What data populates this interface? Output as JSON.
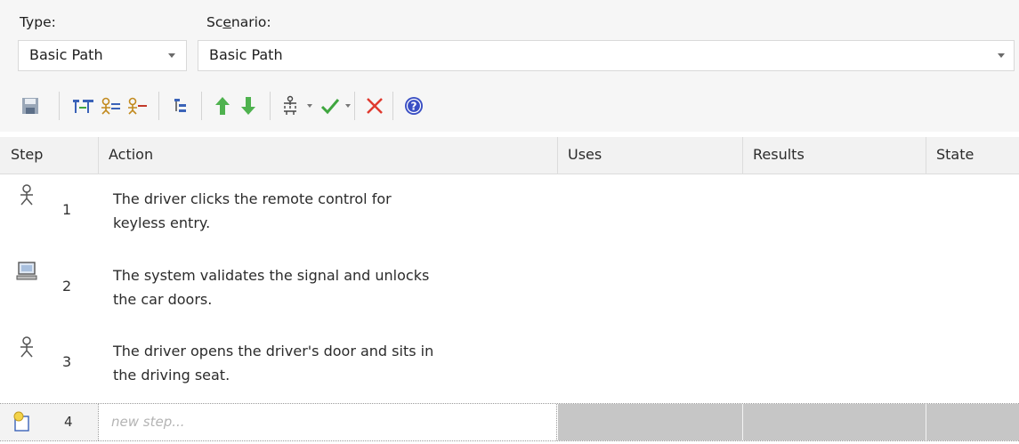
{
  "labels": {
    "type": "Type:",
    "scenario_pre": "Sc",
    "scenario_u": "e",
    "scenario_post": "nario:"
  },
  "combos": {
    "type_value": "Basic Path",
    "scenario_value": "Basic Path"
  },
  "toolbar": {
    "icons": [
      "save-icon",
      "insert-steps-icon",
      "actor-step-icon",
      "system-step-icon",
      "level-icon",
      "move-up-icon",
      "move-down-icon",
      "structure-icon",
      "validate-icon",
      "delete-icon",
      "help-icon"
    ]
  },
  "table": {
    "headers": {
      "step": "Step",
      "action": "Action",
      "uses": "Uses",
      "results": "Results",
      "state": "State"
    },
    "rows": [
      {
        "num": "1",
        "icon": "actor-icon",
        "line1": "The driver clicks the remote control for",
        "line2": "keyless entry."
      },
      {
        "num": "2",
        "icon": "system-icon",
        "line1": "The system validates the signal and unlocks",
        "line2": "the car doors."
      },
      {
        "num": "3",
        "icon": "actor-icon",
        "line1": "The driver opens the driver's door and sits in",
        "line2": "the driving seat."
      }
    ],
    "new_row": {
      "num": "4",
      "placeholder": "new step..."
    }
  },
  "colors": {
    "accent_green": "#3fa63f",
    "delete_red": "#e03a2f",
    "help_blue": "#3a4fc4"
  }
}
